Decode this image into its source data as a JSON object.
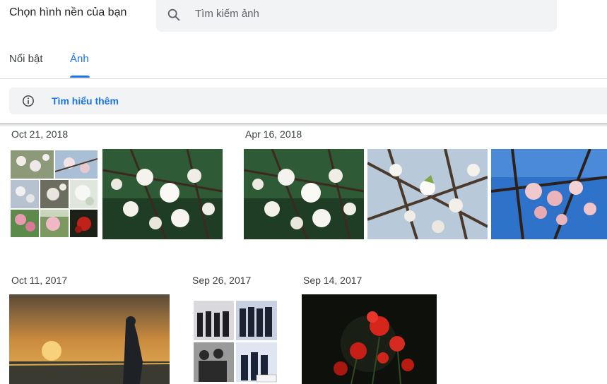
{
  "header": {
    "title": "Chọn hình nền của bạn",
    "search_placeholder": "Tìm kiếm ảnh",
    "search_icon": "search-icon"
  },
  "tabs": [
    {
      "label": "Nổi bật",
      "active": false
    },
    {
      "label": "Ảnh",
      "active": true
    }
  ],
  "banner": {
    "icon": "info-icon",
    "link_label": "Tìm hiểu thêm"
  },
  "groups": [
    {
      "date": "Oct 21, 2018",
      "photos": [
        "collage-flowers",
        "white-blossoms"
      ]
    },
    {
      "date": "Apr 16, 2018",
      "photos": [
        "white-blossoms",
        "blossom-branches",
        "pink-blossoms"
      ]
    },
    {
      "date": "Oct 11, 2017",
      "photos": [
        "sunset-silhouette"
      ]
    },
    {
      "date": "Sep 26, 2017",
      "photos": [
        "group-photo-collage"
      ]
    },
    {
      "date": "Sep 14, 2017",
      "photos": [
        "red-spider-lily"
      ]
    }
  ],
  "colors": {
    "accent": "#1a73e8",
    "surface": "#f1f3f4",
    "text": "#202124"
  }
}
